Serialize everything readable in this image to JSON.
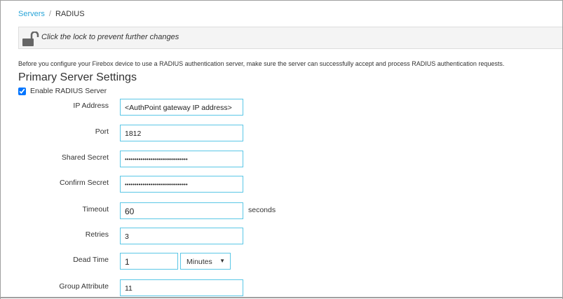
{
  "breadcrumb": {
    "parent": "Servers",
    "separator": "/",
    "current": "RADIUS"
  },
  "lock": {
    "icon": "unlocked-padlock-icon",
    "message": "Click the lock to prevent further changes"
  },
  "intro": "Before you configure your Firebox device to use a RADIUS authentication server, make sure the server can successfully accept and process RADIUS authentication requests.",
  "section_title": "Primary Server Settings",
  "enable": {
    "label": "Enable RADIUS Server",
    "checked": true
  },
  "fields": {
    "ip": {
      "label": "IP Address",
      "value": "<AuthPoint gateway IP address>"
    },
    "port": {
      "label": "Port",
      "value": "1812"
    },
    "secret": {
      "label": "Shared Secret",
      "value": "••••••••••••••••••••••••••••••••"
    },
    "confirm": {
      "label": "Confirm Secret",
      "value": "••••••••••••••••••••••••••••••••"
    },
    "timeout": {
      "label": "Timeout",
      "value": "60",
      "unit": "seconds"
    },
    "retries": {
      "label": "Retries",
      "value": "3"
    },
    "deadtime": {
      "label": "Dead Time",
      "value": "1",
      "unit": "Minutes"
    },
    "group": {
      "label": "Group Attribute",
      "value": "11"
    }
  }
}
